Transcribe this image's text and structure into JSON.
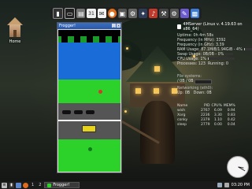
{
  "desktop": {
    "home_label": "Home"
  },
  "dock": {
    "icons": [
      "terminal-icon",
      "monitor-icon",
      "calendar-icon",
      "clock-icon",
      "mail-icon",
      "film-icon",
      "settings-icon",
      "gamepad-icon",
      "music-icon",
      "gear-icon",
      "image-icon"
    ]
  },
  "frogger_window": {
    "title": "Frogger!"
  },
  "conky": {
    "title": "4MServer (Linux v. 4.19.63 on x86_64)",
    "uptime_label": "Uptime:",
    "uptime_value": "0h 4m 58s",
    "freq_mhz_label": "Frequency (in MHz):",
    "freq_mhz_value": "3392",
    "freq_ghz_label": "Frequency (in GHz):",
    "freq_ghz_value": "3.39",
    "ram_label": "RAM Usage:",
    "ram_value": "87.1MiB/1.94GiB - 4%",
    "ram_fraction": 0.04,
    "swap_label": "Swap Usage:",
    "swap_value": "0B/0B - 0%",
    "swap_fraction": 0.0,
    "cpu_label": "CPU Usage:",
    "cpu_value": "1%",
    "cpu_fraction": 0.01,
    "processes_label": "Processes:",
    "processes_value": "123",
    "running_label": "Running:",
    "running_value": "0",
    "fs_label": "File systems:",
    "fs_value": "/ 0B / 0B",
    "net_label": "Networking (eth0):",
    "net_up": "Up: 0B",
    "net_down": "Down: 0B",
    "proc_headers": [
      "Name",
      "PID",
      "CPU%",
      "MEM%"
    ],
    "processes": [
      [
        "wish",
        "2767",
        "6.09",
        "0.94"
      ],
      [
        "Xorg",
        "2236",
        "3.30",
        "0.83"
      ],
      [
        "conky",
        "2379",
        "1.10",
        "0.42"
      ],
      [
        "sleep",
        "2779",
        "0.00",
        "0.04"
      ]
    ]
  },
  "taskbar": {
    "workspaces": [
      "1",
      "2"
    ],
    "task_label": "Frogger!",
    "time": "03:20 PM"
  },
  "colors": {
    "title_bar": "#2a58a8",
    "water": "#1a6cd8",
    "grass": "#2cd12a",
    "bus": "#e7d21c"
  }
}
